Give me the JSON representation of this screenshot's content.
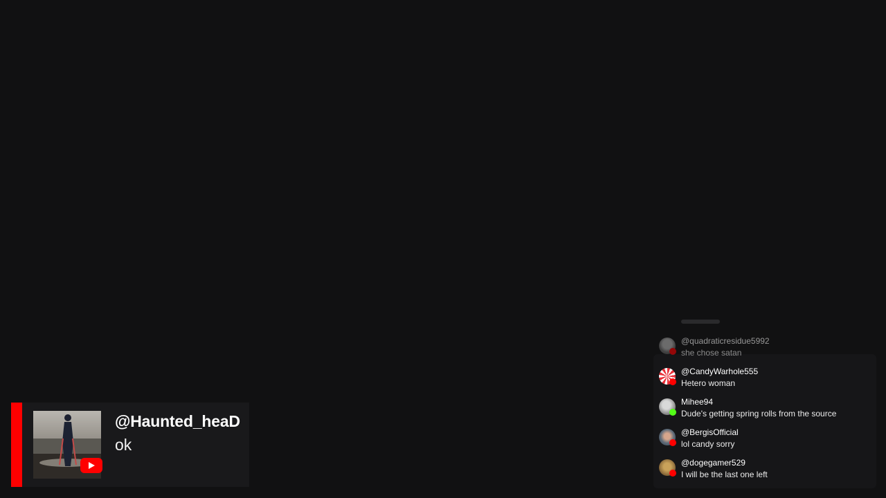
{
  "featured": {
    "username": "@Haunted_heaD",
    "message": "ok",
    "platform_icon": "youtube-icon",
    "accent_color": "#ff0000"
  },
  "chat": {
    "messages": [
      {
        "username": "@quadraticresidue5992",
        "text": "she chose satan",
        "platform": "youtube",
        "avatar": "avatar-grey"
      },
      {
        "username": "@CandyWarhole555",
        "text": "Hetero woman",
        "platform": "youtube",
        "avatar": "avatar-candy"
      },
      {
        "username": "Mihee94",
        "text": "Dude's getting spring rolls from the source",
        "platform": "kick",
        "avatar": "avatar-grey-light"
      },
      {
        "username": "@BergisOfficial",
        "text": "lol candy sorry",
        "platform": "youtube",
        "avatar": "avatar-person"
      },
      {
        "username": "@dogegamer529",
        "text": "I will be the last one left",
        "platform": "youtube",
        "avatar": "avatar-doge"
      }
    ]
  },
  "colors": {
    "background": "#111112",
    "youtube": "#ff0000",
    "kick": "#53fc18"
  }
}
